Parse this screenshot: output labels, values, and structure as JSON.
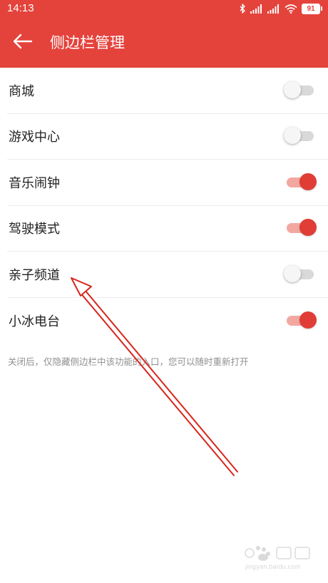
{
  "status_bar": {
    "time": "14:13",
    "battery": "91",
    "icons": [
      "bluetooth-icon",
      "signal-icon",
      "signal-icon",
      "wifi-icon",
      "battery-icon"
    ]
  },
  "app_bar": {
    "title": "侧边栏管理",
    "back_icon": "arrow-left-icon",
    "color": "#e4433c"
  },
  "settings": {
    "items": [
      {
        "label": "商城",
        "enabled": false
      },
      {
        "label": "游戏中心",
        "enabled": false
      },
      {
        "label": "音乐闹钟",
        "enabled": true
      },
      {
        "label": "驾驶模式",
        "enabled": true
      },
      {
        "label": "亲子频道",
        "enabled": false
      },
      {
        "label": "小冰电台",
        "enabled": true
      }
    ]
  },
  "footer": {
    "note": "关闭后，仅隐藏侧边栏中该功能的入口，您可以随时重新打开"
  },
  "watermark": {
    "url": "jingyan.baidu.com"
  },
  "colors": {
    "accent": "#e4433c",
    "switch_on_knob": "#e03d36",
    "switch_on_track": "#f2a8a1",
    "switch_off_track": "#d9d9d9",
    "annotation_arrow": "#d7261c"
  }
}
